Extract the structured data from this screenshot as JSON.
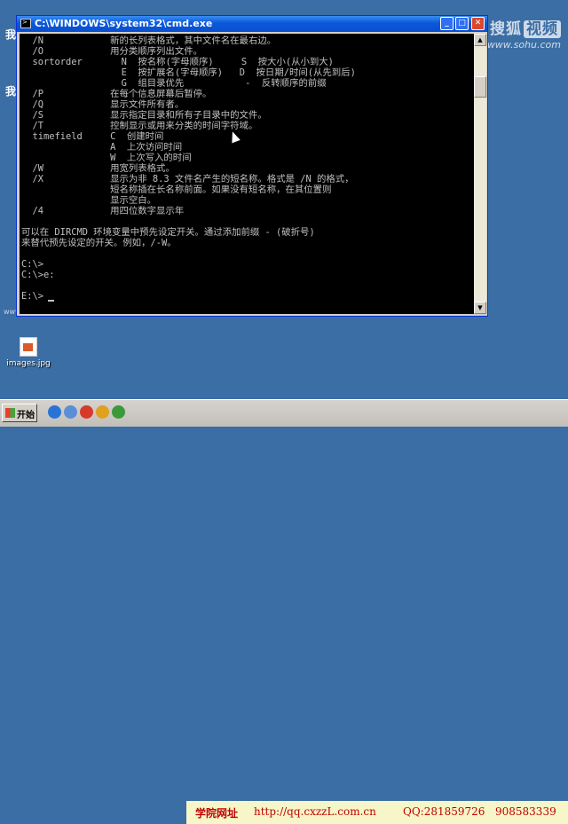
{
  "watermark": {
    "brand": "搜狐",
    "brand_box": "视频",
    "url": "www.sohu.com"
  },
  "desktop": {
    "glyphs": [
      "我",
      "我"
    ],
    "small_text": "www.vodaAth.",
    "icon_label": "images.jpg"
  },
  "window": {
    "title": "C:\\WINDOWS\\system32\\cmd.exe",
    "buttons": {
      "minimize": "_",
      "maximize": "□",
      "close": "✕"
    }
  },
  "console": {
    "lines": [
      "  /N            新的长列表格式，其中文件名在最右边。",
      "  /O            用分类顺序列出文件。",
      "  sortorder       N  按名称(字母顺序)     S  按大小(从小到大)",
      "                  E  按扩展名(字母顺序)   D  按日期/时间(从先到后)",
      "                  G  组目录优先           -  反转顺序的前缀",
      "  /P            在每个信息屏幕后暂停。",
      "  /Q            显示文件所有者。",
      "  /S            显示指定目录和所有子目录中的文件。",
      "  /T            控制显示或用来分类的时间字符域。",
      "  timefield     C  创建时间",
      "                A  上次访问时间",
      "                W  上次写入的时间",
      "  /W            用宽列表格式。",
      "  /X            显示为非 8.3 文件名产生的短名称。格式是 /N 的格式，",
      "                短名称插在长名称前面。如果没有短名称，在其位置则",
      "                显示空白。",
      "  /4            用四位数字显示年",
      "",
      "可以在 DIRCMD 环境变量中预先设定开关。通过添加前缀 - (破折号)",
      "来替代预先设定的开关。例如，/-W。",
      "",
      "C:\\>",
      "C:\\>e:",
      "",
      "E:\\>"
    ]
  },
  "taskbar": {
    "start_label": "开始",
    "banner": {
      "label": "学院网址",
      "url": "http://qq.cxzzL.com.cn",
      "qq": "QQ:281859726",
      "qq2": "908583339"
    }
  }
}
